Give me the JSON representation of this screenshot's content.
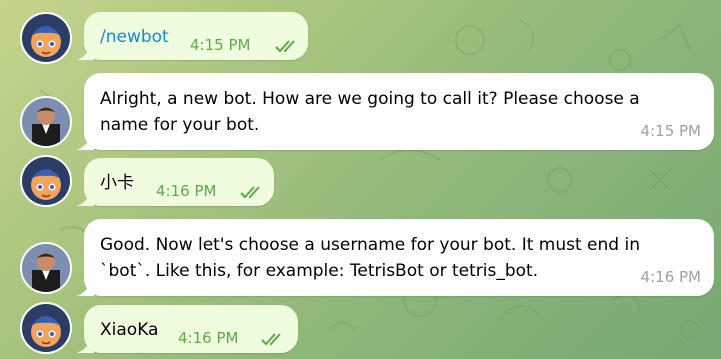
{
  "colors": {
    "outgoing_bubble": "#effdde",
    "incoming_bubble": "#ffffff",
    "command_link": "#168acd",
    "outgoing_time": "#5fa84a",
    "incoming_time": "#a0a0a0"
  },
  "messages": [
    {
      "direction": "outgoing",
      "avatar": "anime-girl-avatar",
      "text": "/newbot",
      "time": "4:15 PM",
      "status": "read-double-check-icon"
    },
    {
      "direction": "incoming",
      "avatar": "botfather-avatar",
      "lines": [
        "Alright, a new bot. How are we going to call it? Please choose a",
        "name for your bot."
      ],
      "time": "4:15 PM"
    },
    {
      "direction": "outgoing",
      "avatar": "anime-girl-avatar",
      "text": "小卡",
      "time": "4:16 PM",
      "status": "read-double-check-icon"
    },
    {
      "direction": "incoming",
      "avatar": "botfather-avatar",
      "lines": [
        "Good. Now let's choose a username for your bot. It must end in",
        "`bot`. Like this, for example: TetrisBot or tetris_bot."
      ],
      "time": "4:16 PM"
    },
    {
      "direction": "outgoing",
      "avatar": "anime-girl-avatar",
      "text": "XiaoKa",
      "time": "4:16 PM",
      "status": "read-double-check-icon"
    }
  ]
}
